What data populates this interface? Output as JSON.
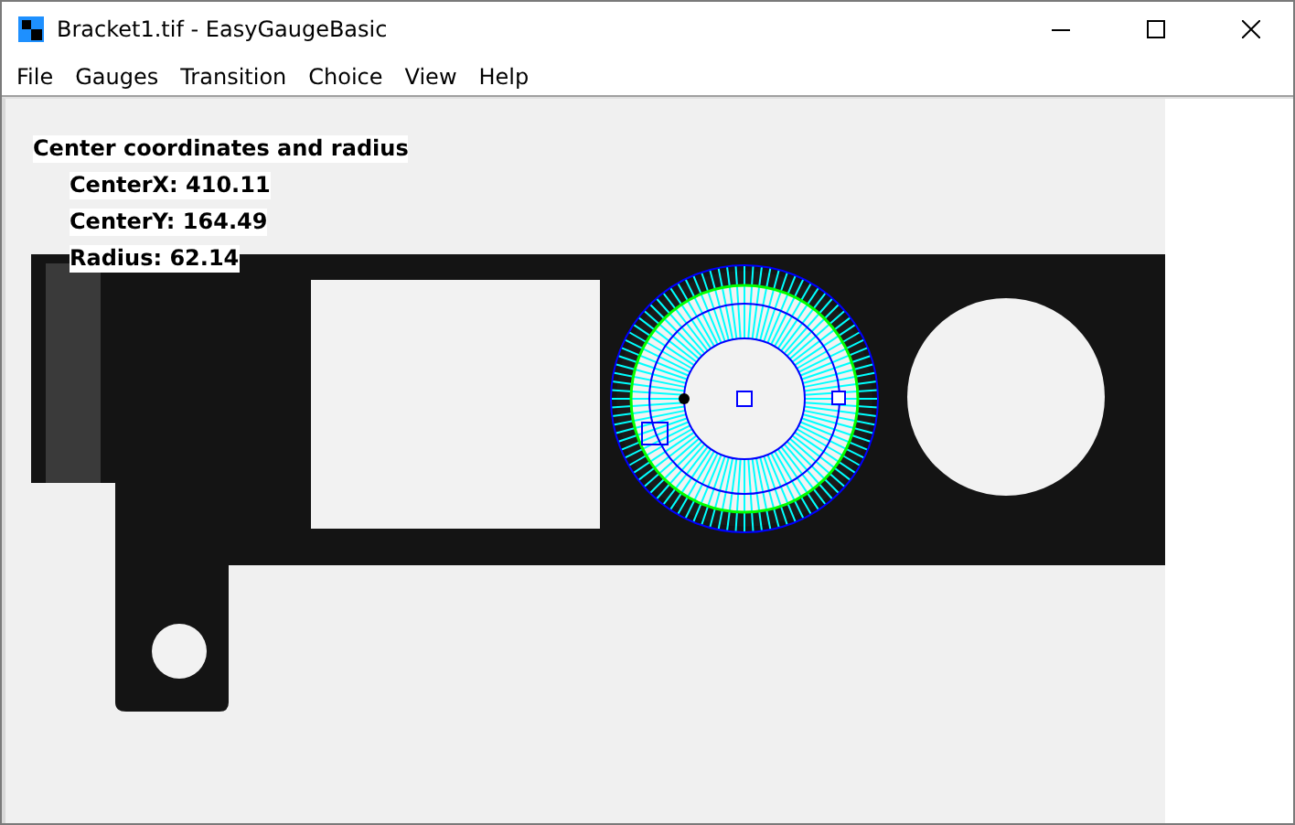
{
  "window": {
    "title": "Bracket1.tif - EasyGaugeBasic"
  },
  "menu": [
    "File",
    "Gauges",
    "Transition",
    "Choice",
    "View",
    "Help"
  ],
  "overlay": {
    "title": "Center coordinates and radius",
    "lines": [
      "CenterX: 410.11",
      "CenterY: 164.49",
      "Radius: 62.14"
    ]
  }
}
